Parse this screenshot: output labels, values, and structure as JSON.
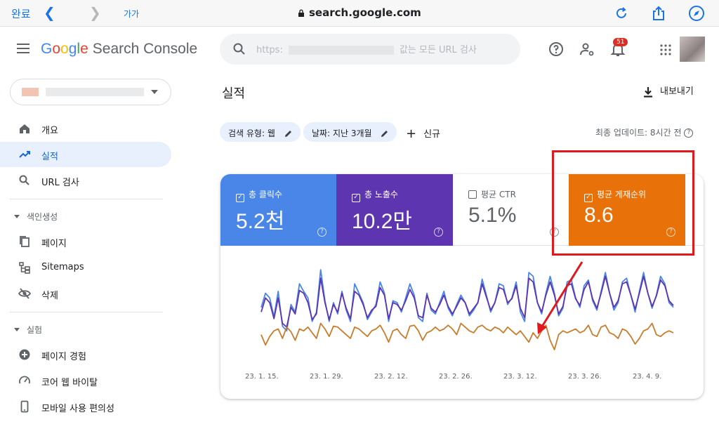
{
  "browser": {
    "done_label": "완료",
    "text_size_label": "가가",
    "url": "search.google.com"
  },
  "app": {
    "logo_letters": [
      "G",
      "o",
      "o",
      "g",
      "l",
      "e"
    ],
    "product_name": "Search Console",
    "search_prefix": "https:",
    "search_suffix": "값는 모든 URL 검사",
    "notification_count": "51"
  },
  "sidebar": {
    "items_top": [
      {
        "label": "개요",
        "icon": "home-icon",
        "active": false
      },
      {
        "label": "실적",
        "icon": "trending-up-icon",
        "active": true
      },
      {
        "label": "URL 검사",
        "icon": "search-icon",
        "active": false
      }
    ],
    "section_indexing": "색인생성",
    "items_indexing": [
      {
        "label": "페이지",
        "icon": "pages-icon"
      },
      {
        "label": "Sitemaps",
        "icon": "sitemap-icon"
      },
      {
        "label": "삭제",
        "icon": "eye-off-icon"
      }
    ],
    "section_experience": "실험",
    "items_experience": [
      {
        "label": "페이지 경험",
        "icon": "plus-circle-icon"
      },
      {
        "label": "코어 웹 바이탈",
        "icon": "gauge-icon"
      },
      {
        "label": "모바일 사용 편의성",
        "icon": "phone-icon"
      }
    ]
  },
  "main": {
    "title": "실적",
    "export_label": "내보내기",
    "filters": [
      {
        "label": "검색 유형: 웹"
      },
      {
        "label": "날짜: 지난 3개월"
      }
    ],
    "new_label": "신규",
    "last_update": "최종 업데이트: 8시간 전",
    "metrics": [
      {
        "label": "총 클릭수",
        "value": "5.2천",
        "checked": true,
        "color": "#4a86e8"
      },
      {
        "label": "총 노출수",
        "value": "10.2만",
        "checked": true,
        "color": "#5e35b1"
      },
      {
        "label": "평균 CTR",
        "value": "5.1%",
        "checked": false,
        "color": "#ffffff"
      },
      {
        "label": "평균 게재순위",
        "value": "8.6",
        "checked": true,
        "color": "#e8710a"
      }
    ]
  },
  "chart_data": {
    "type": "line",
    "categories": [
      "23. 1. 15.",
      "23. 1. 29.",
      "23. 2. 12.",
      "23. 2. 26.",
      "23. 3. 12.",
      "23. 3. 26.",
      "23. 4. 9."
    ],
    "series": [
      {
        "name": "총 클릭수",
        "color": "#4a86e8",
        "values": [
          0.45,
          0.6,
          0.55,
          0.35,
          0.62,
          0.25,
          0.2,
          0.48,
          0.4,
          0.7,
          0.62,
          0.55,
          0.3,
          0.4,
          0.85,
          0.52,
          0.3,
          0.5,
          0.38,
          0.62,
          0.42,
          0.3,
          0.7,
          0.6,
          0.5,
          0.32,
          0.4,
          0.48,
          0.72,
          0.6,
          0.3,
          0.52,
          0.5,
          0.4,
          0.55,
          0.7,
          0.58,
          0.34,
          0.3,
          0.6,
          0.42,
          0.38,
          0.5,
          0.62,
          0.44,
          0.36,
          0.48,
          0.58,
          0.5,
          0.36,
          0.42,
          0.5,
          0.75,
          0.58,
          0.4,
          0.5,
          0.7,
          0.68,
          0.48,
          0.55,
          0.72,
          0.4,
          0.3,
          0.82,
          0.78,
          0.5,
          0.38,
          0.6,
          0.78,
          0.6,
          0.36,
          0.44,
          0.72,
          0.74,
          0.55,
          0.45,
          0.68,
          0.74,
          0.52,
          0.42,
          0.62,
          0.82,
          0.6,
          0.42,
          0.5,
          0.72,
          0.76,
          0.58,
          0.4,
          0.62,
          0.82,
          0.6,
          0.44,
          0.58,
          0.78,
          0.7,
          0.5,
          0.45
        ]
      },
      {
        "name": "총 노출수",
        "color": "#5e35b1",
        "values": [
          0.4,
          0.55,
          0.5,
          0.33,
          0.55,
          0.28,
          0.24,
          0.45,
          0.38,
          0.63,
          0.6,
          0.5,
          0.32,
          0.38,
          0.76,
          0.5,
          0.32,
          0.48,
          0.4,
          0.6,
          0.44,
          0.33,
          0.62,
          0.58,
          0.48,
          0.34,
          0.42,
          0.46,
          0.66,
          0.58,
          0.33,
          0.5,
          0.48,
          0.42,
          0.52,
          0.64,
          0.55,
          0.36,
          0.34,
          0.58,
          0.44,
          0.4,
          0.48,
          0.58,
          0.46,
          0.38,
          0.46,
          0.55,
          0.5,
          0.38,
          0.44,
          0.5,
          0.7,
          0.56,
          0.42,
          0.5,
          0.66,
          0.64,
          0.5,
          0.54,
          0.68,
          0.44,
          0.34,
          0.76,
          0.72,
          0.5,
          0.4,
          0.58,
          0.72,
          0.58,
          0.38,
          0.46,
          0.68,
          0.7,
          0.54,
          0.47,
          0.64,
          0.72,
          0.54,
          0.44,
          0.6,
          0.78,
          0.6,
          0.45,
          0.52,
          0.7,
          0.72,
          0.58,
          0.43,
          0.6,
          0.78,
          0.6,
          0.46,
          0.57,
          0.74,
          0.68,
          0.52,
          0.47
        ]
      },
      {
        "name": "평균 게재순위",
        "color": "#c97c2c",
        "values": [
          0.16,
          0.05,
          0.14,
          0.2,
          0.22,
          0.12,
          0.24,
          0.19,
          0.1,
          0.22,
          0.2,
          0.24,
          0.18,
          0.12,
          0.28,
          0.22,
          0.14,
          0.25,
          0.24,
          0.2,
          0.16,
          0.12,
          0.24,
          0.22,
          0.18,
          0.14,
          0.2,
          0.22,
          0.26,
          0.18,
          0.08,
          0.2,
          0.22,
          0.16,
          0.12,
          0.25,
          0.26,
          0.2,
          0.1,
          0.18,
          0.2,
          0.24,
          0.2,
          0.22,
          0.26,
          0.22,
          0.16,
          0.28,
          0.24,
          0.2,
          0.18,
          0.24,
          0.26,
          0.22,
          0.2,
          0.24,
          0.22,
          0.18,
          0.24,
          0.2,
          0.16,
          0.2,
          0.14,
          0.08,
          0.18,
          0.12,
          0.2,
          0.26,
          0.1,
          0.0,
          0.16,
          0.2,
          0.18,
          0.2,
          0.22,
          0.18,
          0.2,
          0.26,
          0.16,
          0.14,
          0.24,
          0.26,
          0.18,
          0.16,
          0.12,
          0.22,
          0.2,
          0.14,
          0.06,
          0.12,
          0.2,
          0.22,
          0.28,
          0.16,
          0.14,
          0.18,
          0.2,
          0.18
        ]
      }
    ]
  },
  "annotations": {
    "highlight_color": "#e1191d"
  }
}
